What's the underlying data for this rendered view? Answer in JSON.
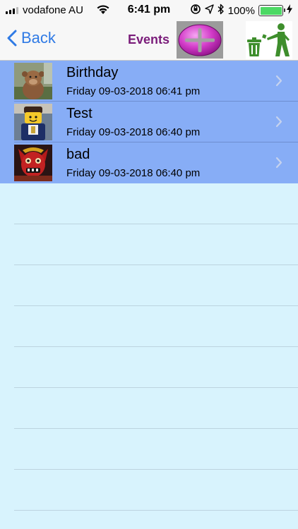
{
  "status_bar": {
    "carrier": "vodafone AU",
    "time": "6:41 pm",
    "battery": "100%",
    "battery_level": 1.0,
    "icons": [
      "signal-icon",
      "wifi-icon",
      "rotation-lock-icon",
      "location-icon",
      "bluetooth-icon",
      "battery-icon",
      "charging-icon"
    ]
  },
  "nav": {
    "back_label": "Back",
    "title": "Events",
    "add_icon": "plus-icon",
    "delete_icon": "trash-person-icon"
  },
  "events": [
    {
      "title": "Birthday",
      "datetime": "Friday 09-03-2018 06:41 pm",
      "thumb": "monkey-photo"
    },
    {
      "title": "Test",
      "datetime": "Friday 09-03-2018 06:40 pm",
      "thumb": "lego-figure-photo"
    },
    {
      "title": "bad",
      "datetime": "Friday 09-03-2018 06:40 pm",
      "thumb": "red-mask-photo"
    }
  ],
  "colors": {
    "accent": "#2f7ae5",
    "title": "#7a1c7a",
    "row_bg": "#87adf6",
    "list_bg": "#d8f3fd"
  }
}
